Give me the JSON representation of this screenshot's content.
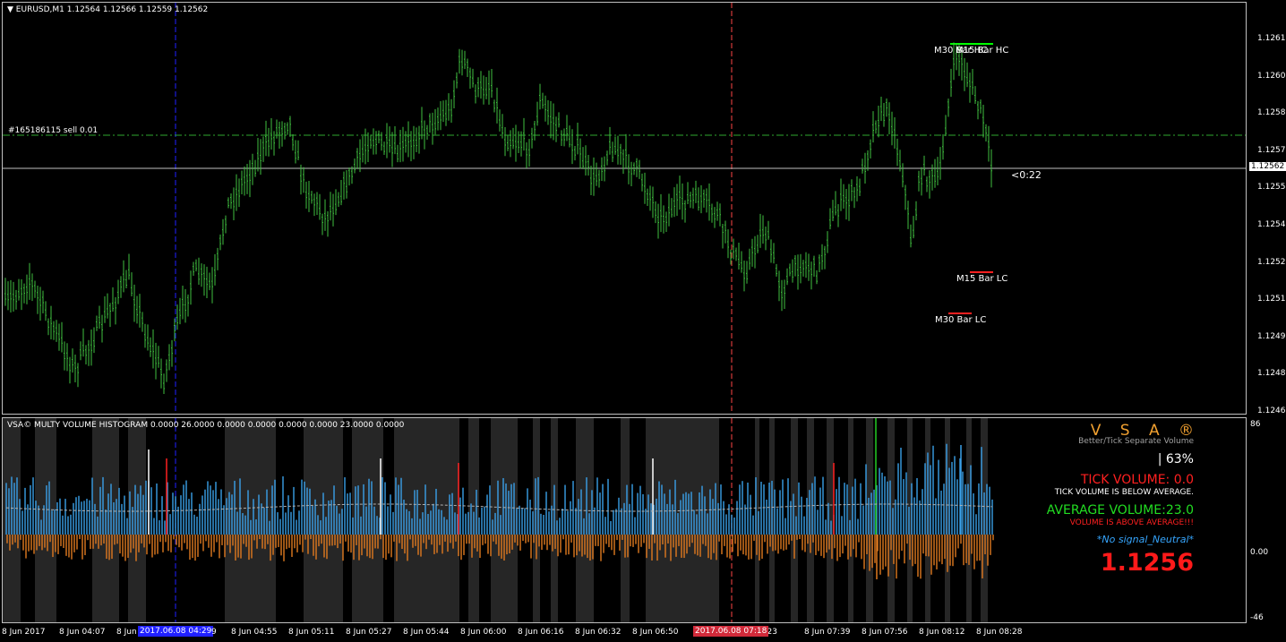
{
  "main_chart": {
    "header": "EURUSD,M1  1.12564 1.12566 1.12559 1.12562",
    "order_label": "#165186115 sell 0.01",
    "countdown": "<0:22",
    "current_price": "1.12562",
    "price_ticks": [
      "1.12615",
      "1.12600",
      "1.12585",
      "1.12570",
      "1.12555",
      "1.12540",
      "1.12525",
      "1.12510",
      "1.12495",
      "1.12480",
      "1.12465"
    ],
    "levels": [
      {
        "label": "M30 Bar HC",
        "color": "#00ff00"
      },
      {
        "label": "M15 Bar HC",
        "color": "#00ff00"
      },
      {
        "label": "M15 Bar LC",
        "color": "#ff2020"
      },
      {
        "label": "M30 Bar LC",
        "color": "#ff2020"
      }
    ],
    "colors": {
      "candle": "#3fbf3f",
      "order_line": "#2fa82f",
      "period_sep_blue": "#1c1cd8",
      "period_sep_red": "#d23a3a"
    }
  },
  "volume_panel": {
    "header": "VSA© MULTY VOLUME HISTOGRAM 0.0000 26.0000 0.0000 0.0000 0.0000 0.0000 23.0000 0.0000",
    "scale": {
      "top": "86",
      "mid": "0.00",
      "bottom": "-46"
    },
    "logo": "V S A ®",
    "subtitle": "Better/Tick Separate Volume",
    "percent": "|  63%",
    "tick_volume": "TICK VOLUME: 0.0",
    "tick_note": "TICK VOLUME IS BELOW AVERAGE.",
    "avg_volume": "AVERAGE VOLUME:23.0",
    "avg_note": "VOLUME IS ABOVE AVERAGE!!!",
    "signal": "*No signal_Neutral*",
    "price": "1.1256",
    "colors": {
      "logo": "#f0a030",
      "tick": "#ff2020",
      "avg": "#22dd22",
      "avg_note": "#ff2020",
      "signal": "#36a6ff",
      "price": "#ff1a1a",
      "up_bar": "#3aa0e8",
      "down_bar": "#e07a20"
    }
  },
  "time_axis": {
    "labels": [
      "8 Jun 2017",
      "8 Jun 04:07",
      "8 Jun",
      "8 Jun 04:55",
      "8 Jun 05:11",
      "8 Jun 05:27",
      "8 Jun 05:44",
      "8 Jun 06:00",
      "8 Jun 06:16",
      "8 Jun 06:32",
      "8 Jun 06:50",
      "07:23",
      "8 Jun 07:39",
      "8 Jun 07:56",
      "8 Jun 08:12",
      "8 Jun 08:28"
    ],
    "cursor_blue": "2017.06.08 04:29",
    "cursor_blue_suffix": "9",
    "cursor_red": "2017.06.08 07:18"
  }
}
